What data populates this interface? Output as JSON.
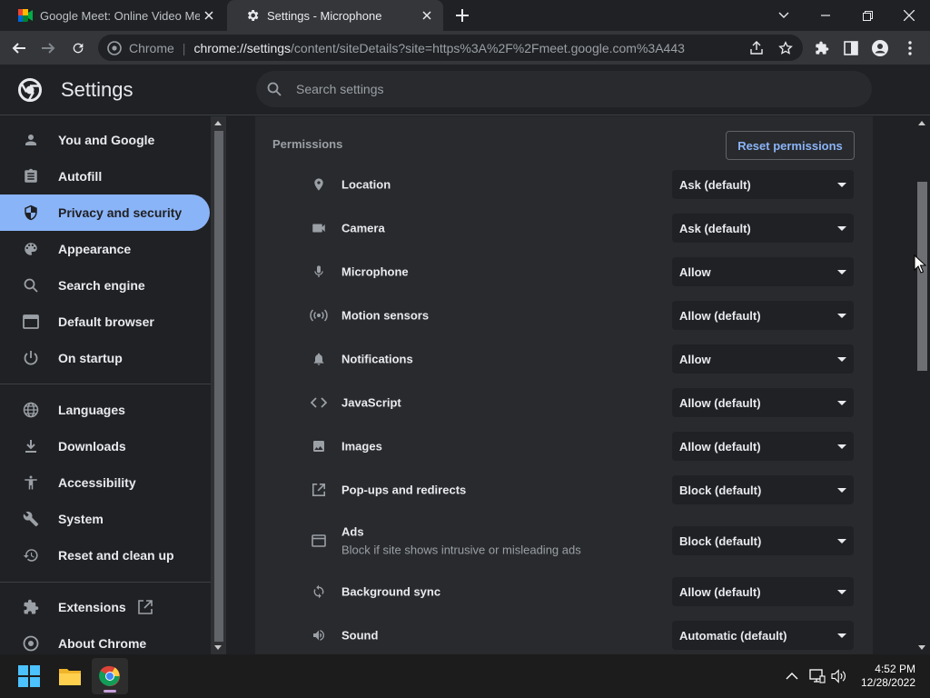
{
  "tabs": [
    {
      "title": "Google Meet: Online Video Meet",
      "active": false
    },
    {
      "title": "Settings - Microphone",
      "active": true
    }
  ],
  "omnibox": {
    "chip": "Chrome",
    "url_host": "chrome://settings",
    "url_path": "/content/siteDetails?site=https%3A%2F%2Fmeet.google.com%3A443"
  },
  "settings": {
    "title": "Settings",
    "search_placeholder": "Search settings"
  },
  "sidebar": {
    "items": [
      {
        "label": "You and Google",
        "icon": "person-icon"
      },
      {
        "label": "Autofill",
        "icon": "clipboard-icon"
      },
      {
        "label": "Privacy and security",
        "icon": "shield-icon",
        "selected": true
      },
      {
        "label": "Appearance",
        "icon": "palette-icon"
      },
      {
        "label": "Search engine",
        "icon": "search-icon"
      },
      {
        "label": "Default browser",
        "icon": "browser-window-icon"
      },
      {
        "label": "On startup",
        "icon": "power-icon"
      },
      {
        "label": "Languages",
        "icon": "globe-icon"
      },
      {
        "label": "Downloads",
        "icon": "download-icon"
      },
      {
        "label": "Accessibility",
        "icon": "accessibility-icon"
      },
      {
        "label": "System",
        "icon": "wrench-icon"
      },
      {
        "label": "Reset and clean up",
        "icon": "restore-icon"
      },
      {
        "label": "Extensions",
        "icon": "puzzle-icon"
      },
      {
        "label": "About Chrome",
        "icon": "chrome-icon"
      }
    ]
  },
  "permissions": {
    "heading": "Permissions",
    "reset_label": "Reset permissions",
    "rows": [
      {
        "label": "Location",
        "value": "Ask (default)",
        "icon": "location-pin-icon"
      },
      {
        "label": "Camera",
        "value": "Ask (default)",
        "icon": "camera-icon"
      },
      {
        "label": "Microphone",
        "value": "Allow",
        "icon": "microphone-icon"
      },
      {
        "label": "Motion sensors",
        "value": "Allow (default)",
        "icon": "sensors-icon"
      },
      {
        "label": "Notifications",
        "value": "Allow",
        "icon": "bell-icon"
      },
      {
        "label": "JavaScript",
        "value": "Allow (default)",
        "icon": "code-icon"
      },
      {
        "label": "Images",
        "value": "Allow (default)",
        "icon": "image-icon"
      },
      {
        "label": "Pop-ups and redirects",
        "value": "Block (default)",
        "icon": "open-in-new-icon"
      },
      {
        "label": "Ads",
        "sublabel": "Block if site shows intrusive or misleading ads",
        "value": "Block (default)",
        "icon": "ads-icon"
      },
      {
        "label": "Background sync",
        "value": "Allow (default)",
        "icon": "sync-icon"
      },
      {
        "label": "Sound",
        "value": "Automatic (default)",
        "icon": "speaker-icon"
      }
    ]
  },
  "taskbar": {
    "time": "4:52 PM",
    "date": "12/28/2022"
  },
  "colors": {
    "accent": "#8ab4f8",
    "background": "#202124",
    "card": "#292a2d"
  }
}
